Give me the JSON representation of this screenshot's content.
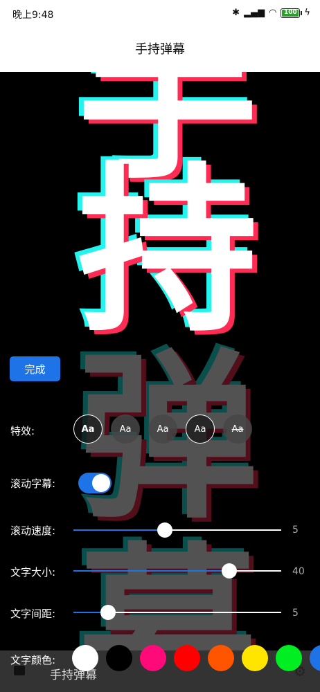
{
  "status": {
    "time": "晚上9:48",
    "battery": "100"
  },
  "app": {
    "title": "手持弹幕"
  },
  "stage": {
    "chars": [
      "手",
      "持",
      "弹",
      "幕"
    ]
  },
  "controls": {
    "done_label": "完成",
    "effects": {
      "label": "特效:",
      "options": [
        "Aa",
        "Aa",
        "Aa",
        "Aa",
        "Aa"
      ]
    },
    "scroll": {
      "label": "滚动字幕:",
      "on": true
    },
    "speed": {
      "label": "滚动速度:",
      "value": "5",
      "fraction": 0.44
    },
    "size": {
      "label": "文字大小:",
      "value": "40",
      "fraction": 0.75
    },
    "spacing": {
      "label": "文字间距:",
      "value": "5",
      "fraction": 0.165
    },
    "color": {
      "label": "文字颜色:",
      "swatches": [
        "#ffffff",
        "#000000",
        "#ff0a78",
        "#ff0000",
        "#ff5500",
        "#ffe500",
        "#00ee22",
        "#1e74e6"
      ]
    }
  },
  "bottom_nav": {
    "title": "手持弹幕"
  }
}
